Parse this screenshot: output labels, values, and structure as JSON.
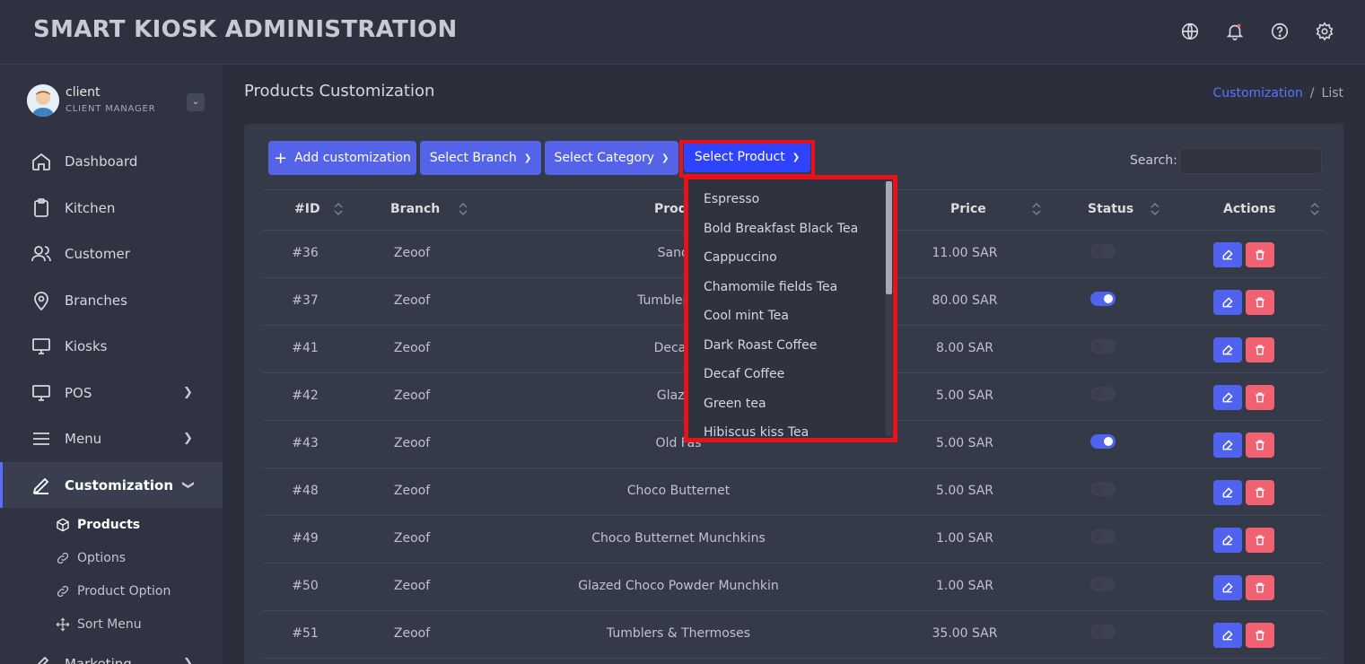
{
  "app": {
    "title": "SMART KIOSK ADMINISTRATION"
  },
  "header_icons": [
    "globe-icon",
    "bell-icon",
    "help-icon",
    "gear-icon"
  ],
  "user": {
    "name": "client",
    "role": "CLIENT MANAGER"
  },
  "nav": {
    "items": [
      {
        "label": "Dashboard",
        "icon": "home-icon"
      },
      {
        "label": "Kitchen",
        "icon": "clipboard-icon"
      },
      {
        "label": "Customer",
        "icon": "users-icon"
      },
      {
        "label": "Branches",
        "icon": "map-pin-icon"
      },
      {
        "label": "Kiosks",
        "icon": "monitor-icon"
      },
      {
        "label": "POS",
        "icon": "monitor-icon"
      },
      {
        "label": "Menu",
        "icon": "menu-icon"
      },
      {
        "label": "Customization",
        "icon": "pen-icon"
      },
      {
        "label": "Marketing",
        "icon": "pen-icon"
      }
    ],
    "sub_items": [
      {
        "label": "Products",
        "icon": "box-icon"
      },
      {
        "label": "Options",
        "icon": "link-icon"
      },
      {
        "label": "Product Option",
        "icon": "link-icon"
      },
      {
        "label": "Sort Menu",
        "icon": "move-icon"
      }
    ]
  },
  "page": {
    "title": "Products Customization",
    "breadcrumb": {
      "link": "Customization",
      "sep": "/",
      "current": "List"
    }
  },
  "toolbar": {
    "add_label": "Add customization",
    "branch_label": "Select Branch",
    "category_label": "Select Category",
    "product_label": "Select Product",
    "search_label": "Search:"
  },
  "table": {
    "headers": [
      "#ID",
      "Branch",
      "Prod",
      "Price",
      "Status",
      "Actions"
    ],
    "rows": [
      {
        "id": "#36",
        "branch": "Zeoof",
        "product": "Sandw",
        "price": "11.00 SAR",
        "status": false
      },
      {
        "id": "#37",
        "branch": "Zeoof",
        "product": "Tumblers & T",
        "price": "80.00 SAR",
        "status": true
      },
      {
        "id": "#41",
        "branch": "Zeoof",
        "product": "Decaf C",
        "price": "8.00 SAR",
        "status": false
      },
      {
        "id": "#42",
        "branch": "Zeoof",
        "product": "Glazed",
        "price": "5.00 SAR",
        "status": false
      },
      {
        "id": "#43",
        "branch": "Zeoof",
        "product": "Old Fas",
        "price": "5.00 SAR",
        "status": true
      },
      {
        "id": "#48",
        "branch": "Zeoof",
        "product": "Choco Butternet",
        "price": "5.00 SAR",
        "status": false
      },
      {
        "id": "#49",
        "branch": "Zeoof",
        "product": "Choco Butternet Munchkins",
        "price": "1.00 SAR",
        "status": false
      },
      {
        "id": "#50",
        "branch": "Zeoof",
        "product": "Glazed Choco Powder Munchkin",
        "price": "1.00 SAR",
        "status": false
      },
      {
        "id": "#51",
        "branch": "Zeoof",
        "product": "Tumblers & Thermoses",
        "price": "35.00 SAR",
        "status": false
      }
    ]
  },
  "dropdown": {
    "options": [
      "Espresso",
      "Bold Breakfast Black Tea",
      "Cappuccino",
      "Chamomile fields Tea",
      "Cool mint Tea",
      "Dark Roast Coffee",
      "Decaf Coffee",
      "Green tea",
      "Hibiscus kiss Tea"
    ]
  },
  "colors": {
    "accent": "#5563e8",
    "highlight": "#e8121c",
    "danger": "#f06272"
  }
}
